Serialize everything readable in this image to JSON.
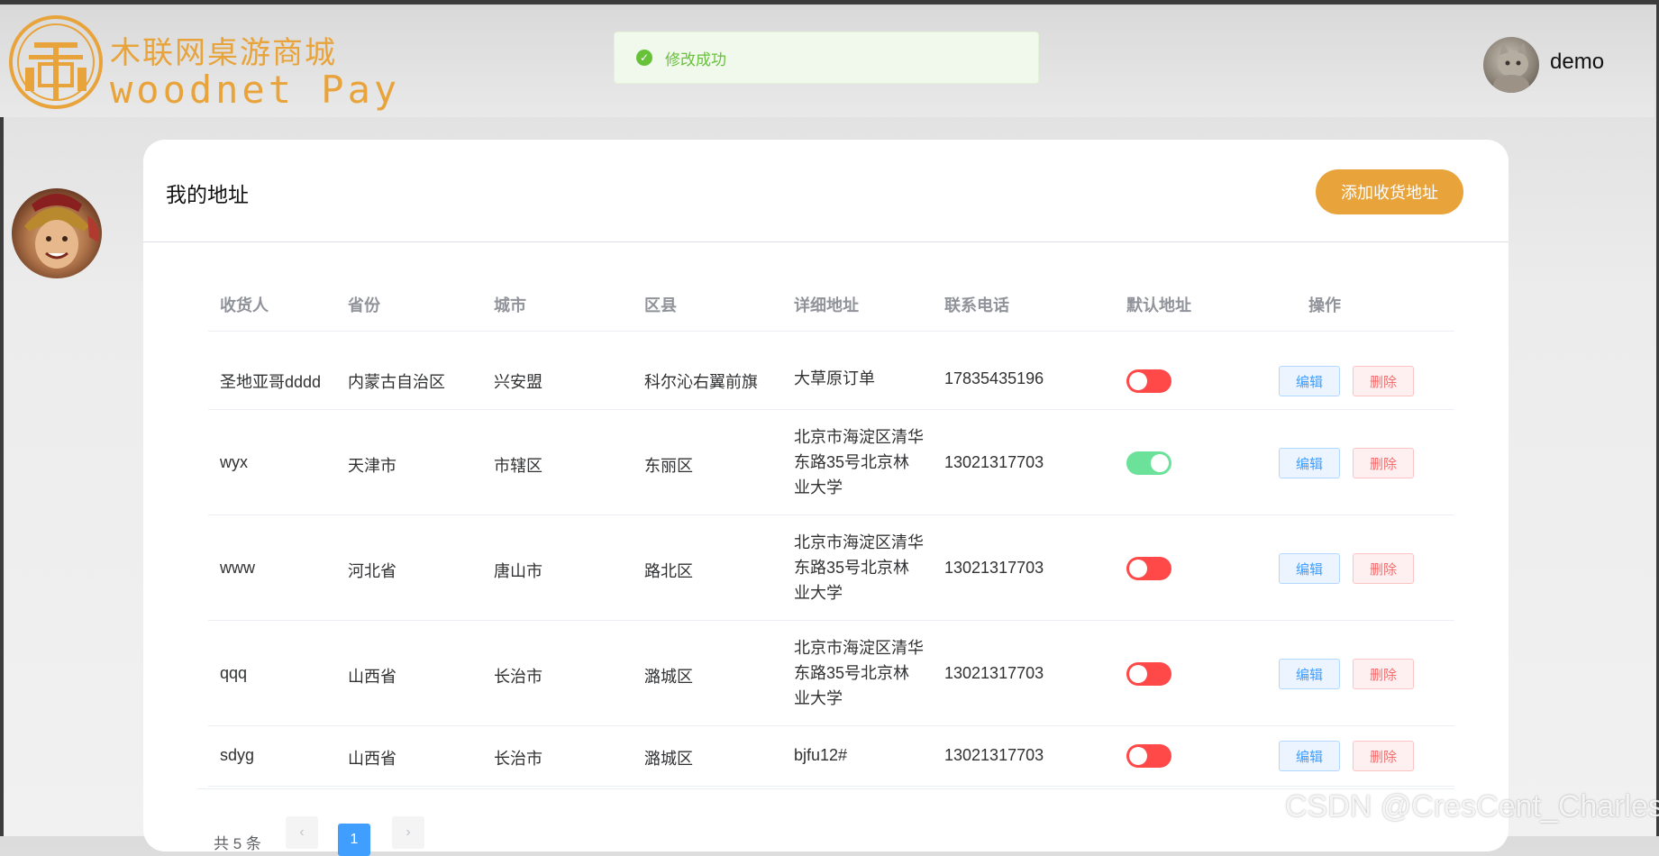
{
  "header": {
    "brand_cn": "木联网桌游商城",
    "brand_en": "woodnet Pay",
    "user_name": "demo"
  },
  "toast": {
    "message": "修改成功"
  },
  "page": {
    "title": "我的地址",
    "add_button": "添加收货地址"
  },
  "table": {
    "columns": [
      "收货人",
      "省份",
      "城市",
      "区县",
      "详细地址",
      "联系电话",
      "默认地址",
      "操作"
    ],
    "edit_label": "编辑",
    "delete_label": "删除",
    "rows": [
      {
        "name": "圣地亚哥dddd",
        "province": "内蒙古自治区",
        "city": "兴安盟",
        "district": "科尔沁右翼前旗",
        "address_lines": [
          "大草原订单"
        ],
        "phone": "17835435196",
        "is_default": false
      },
      {
        "name": "wyx",
        "province": "天津市",
        "city": "市辖区",
        "district": "东丽区",
        "address_lines": [
          "北京市海淀区清华",
          "东路35号北京林",
          "业大学"
        ],
        "phone": "13021317703",
        "is_default": true
      },
      {
        "name": "www",
        "province": "河北省",
        "city": "唐山市",
        "district": "路北区",
        "address_lines": [
          "北京市海淀区清华",
          "东路35号北京林",
          "业大学"
        ],
        "phone": "13021317703",
        "is_default": false
      },
      {
        "name": "qqq",
        "province": "山西省",
        "city": "长治市",
        "district": "潞城区",
        "address_lines": [
          "北京市海淀区清华",
          "东路35号北京林",
          "业大学"
        ],
        "phone": "13021317703",
        "is_default": false
      },
      {
        "name": "sdyg",
        "province": "山西省",
        "city": "长治市",
        "district": "潞城区",
        "address_lines": [
          "bjfu12#"
        ],
        "phone": "13021317703",
        "is_default": false
      }
    ]
  },
  "pagination": {
    "total_text": "共 5 条",
    "current_page": "1",
    "prev_icon": "chevron-left-icon",
    "next_icon": "chevron-right-icon"
  },
  "watermark": "CSDN @CresCent_Charles",
  "colors": {
    "accent": "#e8a33a",
    "success": "#67c23a",
    "switch_on": "#6be19a",
    "switch_off": "#ff4949",
    "primary": "#409eff",
    "danger": "#f56c6c"
  }
}
